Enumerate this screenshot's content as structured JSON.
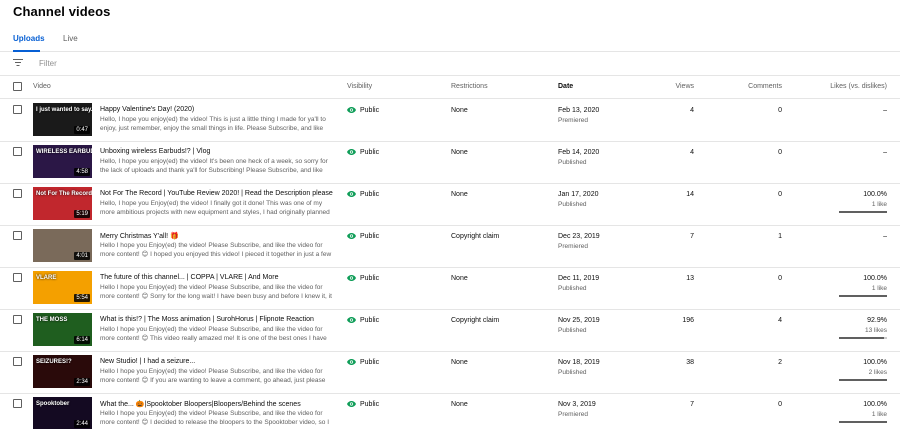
{
  "page": {
    "title": "Channel videos"
  },
  "tabs": [
    {
      "label": "Uploads",
      "active": true
    },
    {
      "label": "Live",
      "active": false
    }
  ],
  "filter": {
    "placeholder": "Filter",
    "icon": "filter-icon"
  },
  "table": {
    "headers": {
      "video": "Video",
      "visibility": "Visibility",
      "restrictions": "Restrictions",
      "date": "Date",
      "views": "Views",
      "comments": "Comments",
      "likes": "Likes (vs. dislikes)"
    },
    "rows": [
      {
        "thumb_text": "I just wanted to say..",
        "thumb_color": "#1a1a1a",
        "duration": "0:47",
        "title": "Happy Valentine's Day! (2020)",
        "desc": "Hello, I hope you enjoy(ed) the video! This is just a little thing I made for ya'll to enjoy, just remember, enjoy the small things in life. Please Subscribe, and like the video fo...",
        "visibility": "Public",
        "restrictions": "None",
        "date": "Feb 13, 2020",
        "date_status": "Premiered",
        "views": "4",
        "comments": "0",
        "likes": "–",
        "likes_sub": "",
        "like_ratio": null
      },
      {
        "thumb_text": "WIRELESS EARBUDS!?",
        "thumb_color": "#2b1746",
        "duration": "4:58",
        "title": "Unboxing wireless Earbuds!? | Vlog",
        "desc": "Hello, I hope you enjoy(ed) the video! It's been one heck of a week, so sorry for the lack of uploads and thank ya'll for Subscribing! Please Subscribe, and like the video fo...",
        "visibility": "Public",
        "restrictions": "None",
        "date": "Feb 14, 2020",
        "date_status": "Published",
        "views": "4",
        "comments": "0",
        "likes": "–",
        "likes_sub": "",
        "like_ratio": null
      },
      {
        "thumb_text": "Not For The Record",
        "thumb_color": "#c1272d",
        "duration": "5:19",
        "title": "Not For The Record | YouTube Review 2020! | Read the Description please",
        "desc": "Hello, I hope you Enjoy(ed) the video! I finally got it done! This was one of my more ambitious projects with new equipment and styles, I had originally planned it to...",
        "visibility": "Public",
        "restrictions": "None",
        "date": "Jan 17, 2020",
        "date_status": "Published",
        "views": "14",
        "comments": "0",
        "likes": "100.0%",
        "likes_sub": "1 like",
        "like_ratio": 1.0
      },
      {
        "thumb_text": "",
        "thumb_color": "#7a6a5a",
        "duration": "4:01",
        "title": "Merry Christmas Y'all! 🎁",
        "desc": "Hello I hope you Enjoy(ed) the video! Please Subscribe, and like the video for more content! 😊 I hoped you enjoyed this video! I pieced it together in just a few hours!...",
        "visibility": "Public",
        "restrictions": "Copyright claim",
        "date": "Dec 23, 2019",
        "date_status": "Premiered",
        "views": "7",
        "comments": "1",
        "likes": "–",
        "likes_sub": "",
        "like_ratio": null
      },
      {
        "thumb_text": "VLARE",
        "thumb_color": "#f4a000",
        "duration": "5:54",
        "title": "The future of this channel... | COPPA | VLARE | And More",
        "desc": "Hello I hope you Enjoy(ed) the video! Please Subscribe, and like the video for more content! 😊 Sorry for the long wait! I have been busy and before I knew it, it was...",
        "visibility": "Public",
        "restrictions": "None",
        "date": "Dec 11, 2019",
        "date_status": "Published",
        "views": "13",
        "comments": "0",
        "likes": "100.0%",
        "likes_sub": "1 like",
        "like_ratio": 1.0
      },
      {
        "thumb_text": "THE MOSS",
        "thumb_color": "#1f5e1f",
        "duration": "6:14",
        "title": "What is this!? | The Moss animation | SurohHorus | Flipnote Reaction",
        "desc": "Hello I hope you Enjoy(ed) the video! Please Subscribe, and like the video for more content! 😊 This video really amazed me! It is one of the best ones I have seen in a...",
        "visibility": "Public",
        "restrictions": "Copyright claim",
        "date": "Nov 25, 2019",
        "date_status": "Published",
        "views": "196",
        "comments": "4",
        "likes": "92.9%",
        "likes_sub": "13 likes",
        "like_ratio": 0.929
      },
      {
        "thumb_text": "SEIZURES!?",
        "thumb_color": "#2a0a0a",
        "duration": "2:34",
        "title": "New Studio! | I had a seizure...",
        "desc": "Hello I hope you Enjoy(ed) the video! Please Subscribe, and like the video for more content! 😊 If you are wanting to leave a comment, go ahead, just please follow...",
        "visibility": "Public",
        "restrictions": "None",
        "date": "Nov 18, 2019",
        "date_status": "Published",
        "views": "38",
        "comments": "2",
        "likes": "100.0%",
        "likes_sub": "2 likes",
        "like_ratio": 1.0
      },
      {
        "thumb_text": "Spooktober",
        "thumb_color": "#140a22",
        "duration": "2:44",
        "title": "What the... 🎃|Spooktober Bloopers|Bloopers/Behind the scenes",
        "desc": "Hello I hope you Enjoy(ed) the video! Please Subscribe, and like the video for more content! 😊 I decided to release the bloopers to the Spooktober video, so I hope you...",
        "visibility": "Public",
        "restrictions": "None",
        "date": "Nov 3, 2019",
        "date_status": "Premiered",
        "views": "7",
        "comments": "0",
        "likes": "100.0%",
        "likes_sub": "1 like",
        "like_ratio": 1.0
      }
    ]
  },
  "colors": {
    "accent": "#065fd4",
    "public_green": "#0f9d58",
    "divider": "#e5e5e5"
  }
}
